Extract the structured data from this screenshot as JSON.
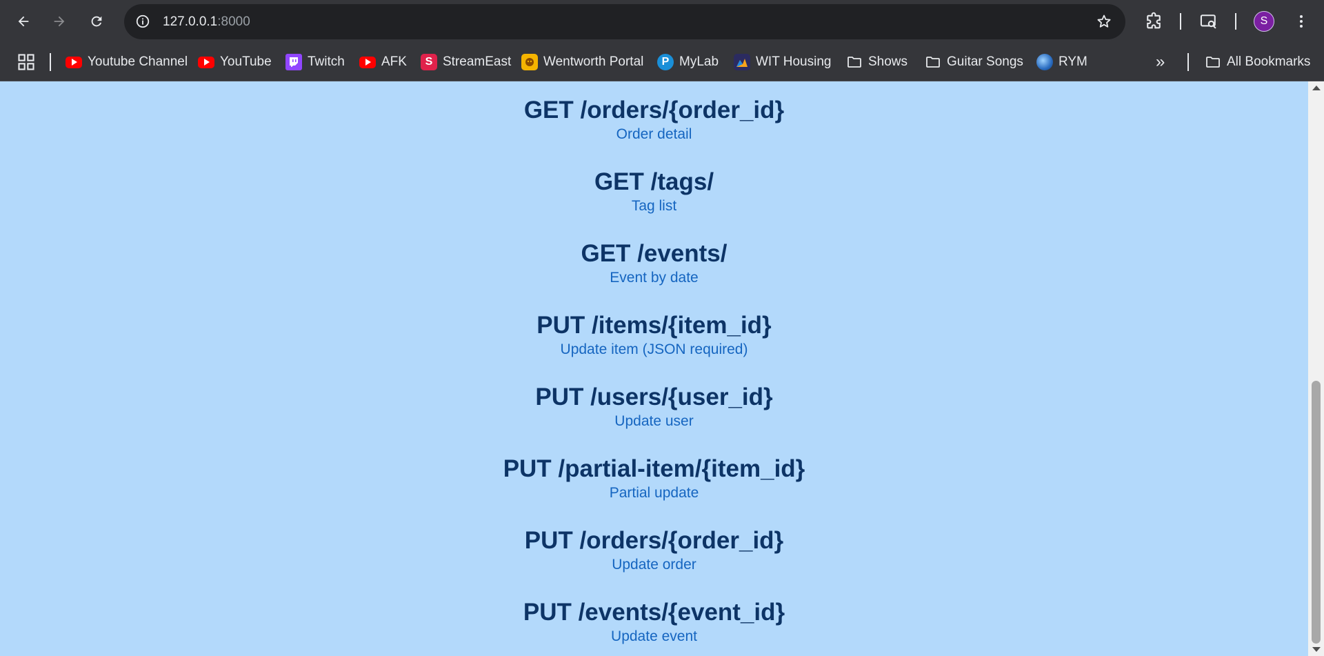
{
  "browser": {
    "url_host": "127.0.0.1",
    "url_port": ":8000",
    "profile_initial": "S",
    "icons": {
      "back": "arrow-left-icon",
      "forward": "arrow-right-icon",
      "reload": "reload-icon",
      "site_info": "info-icon",
      "bookmark_star": "star-icon",
      "extensions": "puzzle-icon",
      "search_tabs": "tab-search-icon",
      "menu": "kebab-menu-icon"
    }
  },
  "bookmarks": {
    "items": [
      {
        "label": "Youtube Channel",
        "icon": "youtube-icon"
      },
      {
        "label": "YouTube",
        "icon": "youtube-icon"
      },
      {
        "label": "Twitch",
        "icon": "twitch-icon"
      },
      {
        "label": "AFK",
        "icon": "youtube-icon"
      },
      {
        "label": "StreamEast",
        "icon": "streameast-icon"
      },
      {
        "label": "Wentworth Portal",
        "icon": "wentworth-icon"
      },
      {
        "label": "MyLab",
        "icon": "mylab-icon"
      },
      {
        "label": "WIT Housing",
        "icon": "wit-icon"
      },
      {
        "label": "Shows",
        "icon": "folder-icon"
      },
      {
        "label": "Guitar Songs",
        "icon": "folder-icon"
      },
      {
        "label": "RYM",
        "icon": "rym-icon"
      }
    ],
    "more": "»",
    "all_bookmarks": "All Bookmarks"
  },
  "endpoints": [
    {
      "route": "GET /orders/{order_id}",
      "desc": "Order detail"
    },
    {
      "route": "GET /tags/",
      "desc": "Tag list"
    },
    {
      "route": "GET /events/",
      "desc": "Event by date"
    },
    {
      "route": "PUT /items/{item_id}",
      "desc": "Update item (JSON required)"
    },
    {
      "route": "PUT /users/{user_id}",
      "desc": "Update user"
    },
    {
      "route": "PUT /partial-item/{item_id}",
      "desc": "Partial update"
    },
    {
      "route": "PUT /orders/{order_id}",
      "desc": "Update order"
    },
    {
      "route": "PUT /events/{event_id}",
      "desc": "Update event"
    }
  ],
  "colors": {
    "page_background": "#b3d9fb",
    "route_text": "#0d3466",
    "description_text": "#1565c0",
    "toolbar": "#35363a",
    "profile_avatar": "#7b1fa2"
  }
}
